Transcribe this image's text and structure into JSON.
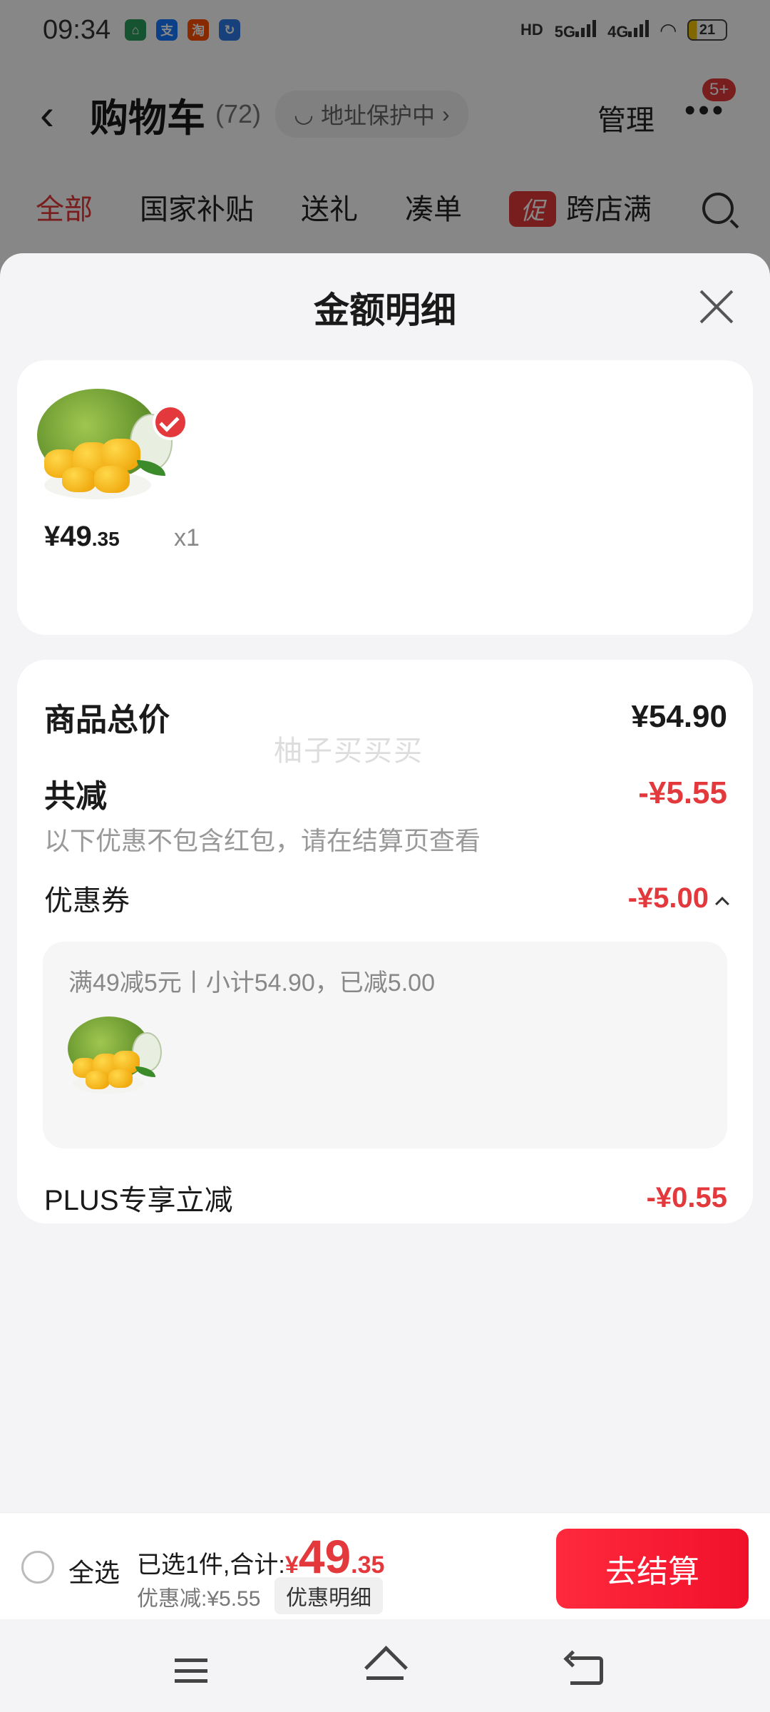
{
  "status_bar": {
    "time": "09:34",
    "network_5g": "5G",
    "network_4g": "4G",
    "battery": "21"
  },
  "header": {
    "title": "购物车",
    "count": "(72)",
    "address_protection": "地址保护中",
    "manage": "管理",
    "badge": "5+"
  },
  "tabs": [
    "全部",
    "国家补贴",
    "送礼",
    "凑单",
    "跨店满减"
  ],
  "promo_icon": "促",
  "sheet": {
    "title": "金额明细",
    "product": {
      "price_int": "¥49",
      "price_dec": ".35",
      "qty": "x1"
    },
    "total_label": "商品总价",
    "total_value": "¥54.90",
    "discount_label": "共减",
    "discount_value": "-¥5.55",
    "discount_note": "以下优惠不包含红包，请在结算页查看",
    "coupon_label": "优惠券",
    "coupon_value": "-¥5.00",
    "coupon_detail": "满49减5元丨小计54.90，已减5.00",
    "plus_label": "PLUS专享立减",
    "plus_value": "-¥0.55",
    "watermark": "柚子买买买"
  },
  "bottom_bar": {
    "select_all": "全选",
    "selected_text": "已选1件,合计:",
    "currency": "¥",
    "total_int": "49",
    "total_dec": ".35",
    "discount_text": "优惠减:¥5.55",
    "detail_button": "优惠明细",
    "checkout_button": "去结算"
  },
  "colors": {
    "accent": "#e4393c",
    "checkout": "#f0102a"
  }
}
